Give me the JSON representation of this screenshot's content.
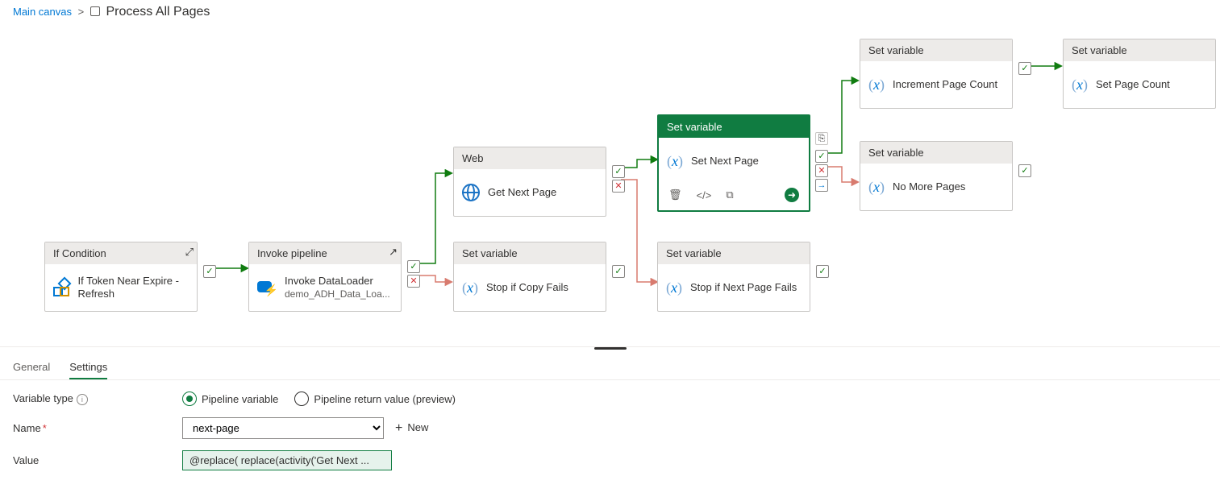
{
  "breadcrumb": {
    "root": "Main canvas",
    "sep": ">",
    "current": "Process All Pages"
  },
  "nodes": {
    "ifcond": {
      "type": "If Condition",
      "title": "If Token Near Expire - Refresh"
    },
    "invoke": {
      "type": "Invoke pipeline",
      "title": "Invoke DataLoader",
      "sub": "demo_ADH_Data_Loa..."
    },
    "web": {
      "type": "Web",
      "title": "Get Next Page"
    },
    "stopcopy": {
      "type": "Set variable",
      "title": "Stop if Copy Fails"
    },
    "setnext": {
      "type": "Set variable",
      "title": "Set Next Page"
    },
    "stopnext": {
      "type": "Set variable",
      "title": "Stop if Next Page Fails"
    },
    "incpage": {
      "type": "Set variable",
      "title": "Increment Page Count"
    },
    "nomore": {
      "type": "Set variable",
      "title": "No More Pages"
    },
    "setpage": {
      "type": "Set variable",
      "title": "Set Page Count"
    }
  },
  "panel": {
    "tabs": {
      "general": "General",
      "settings": "Settings"
    },
    "vartype_label": "Variable type",
    "vartype_opts": {
      "pipeline": "Pipeline variable",
      "return": "Pipeline return value (preview)"
    },
    "name_label": "Name",
    "name_value": "next-page",
    "new_label": "New",
    "value_label": "Value",
    "value_expr": "@replace( replace(activity('Get Next ..."
  }
}
